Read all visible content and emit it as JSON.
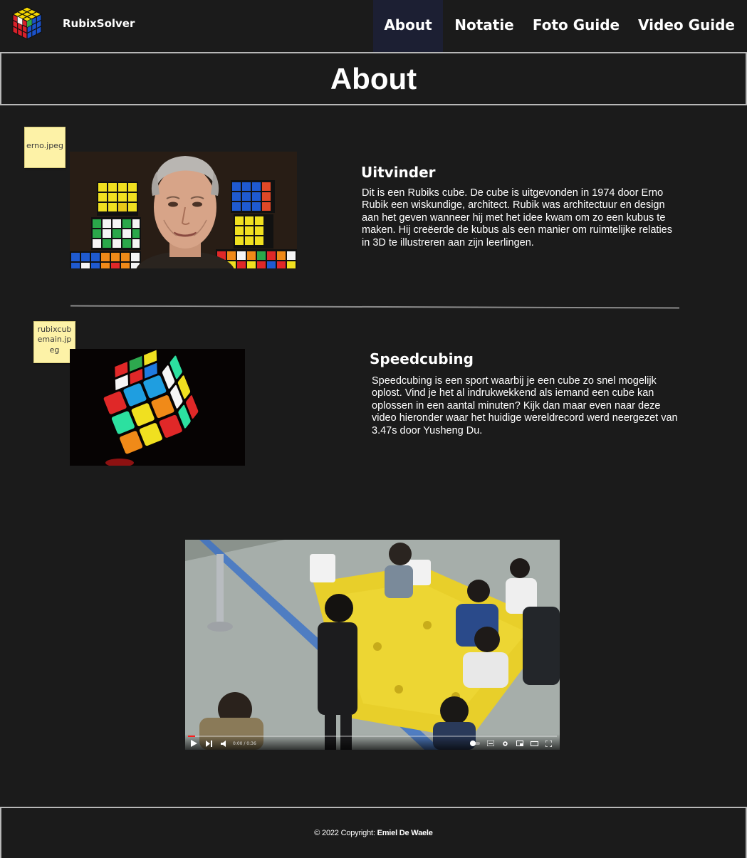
{
  "nav": {
    "brand": "RubixSolver",
    "items": [
      {
        "label": "About",
        "active": true
      },
      {
        "label": "Notatie",
        "active": false
      },
      {
        "label": "Foto Guide",
        "active": false
      },
      {
        "label": "Video Guide",
        "active": false
      }
    ]
  },
  "page": {
    "title": "About"
  },
  "sections": [
    {
      "image_alt": "erno.jpeg",
      "heading": "Uitvinder",
      "text": "Dit is een Rubiks cube. De cube is uitgevonden in 1974 door Erno Rubik een wiskundige, architect. Rubik was architectuur en design aan het geven wanneer hij met het idee kwam om zo een kubus te maken. Hij creëerde de kubus als een manier om ruimtelijke relaties in 3D te illustreren aan zijn leerlingen."
    },
    {
      "image_alt": "rubixcubemain.jpeg",
      "heading": "Speedcubing",
      "text": "Speedcubing is een sport waarbij je een cube zo snel mogelijk oplost. Vind je het al indrukwekkend als iemand een cube kan oplossen in een aantal minuten? Kijk dan maar even naar deze video hieronder waar het huidige wereldrecord werd neergezet van 3.47s door Yusheng Du."
    }
  ],
  "video": {
    "time": "0:00 / 0:36",
    "progress": 0.02
  },
  "footer": {
    "prefix": "© 2022 Copyright:",
    "author": "Emiel De Waele"
  },
  "colors": {
    "background": "#1b1b1b",
    "active_nav": "#1c1f33",
    "border": "#b8b8b8",
    "alt_tag": "#fdf2a7"
  }
}
